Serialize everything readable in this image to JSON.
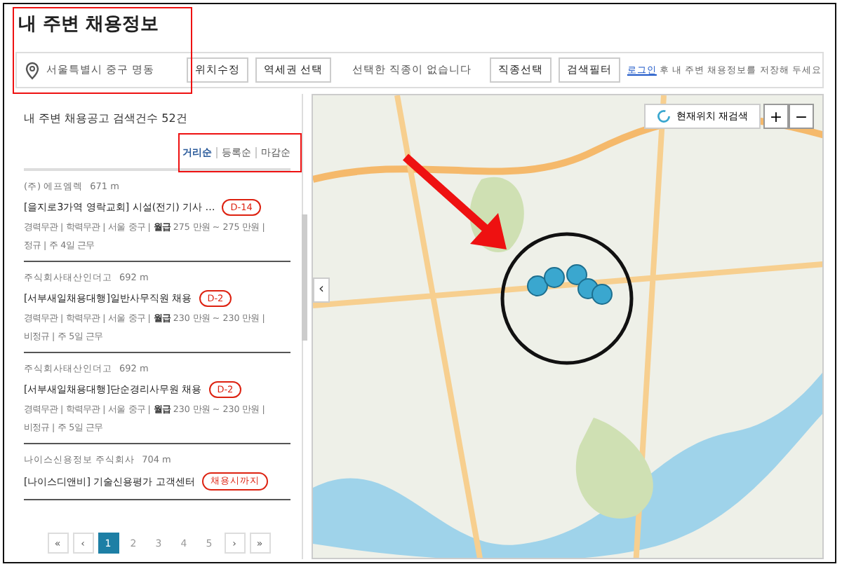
{
  "title": "내 주변 채용정보",
  "toolbar": {
    "location": "서울특별시 중구 명동",
    "location_buttons": [
      "위치수정",
      "역세권 선택"
    ],
    "job_type": "선택한 직종이 없습니다",
    "job_buttons": [
      "직종선택",
      "검색필터"
    ],
    "login_link": "로그인",
    "login_note": " 후 내 주변 채용정보를 저장해 두세요"
  },
  "list": {
    "heading": "내 주변 채용공고 검색건수 52건",
    "sort": [
      {
        "label": "거리순",
        "selected": true
      },
      {
        "label": "등록순",
        "selected": false
      },
      {
        "label": "마감순",
        "selected": false
      }
    ],
    "jobs": [
      {
        "company": "(주) 에프엠렉",
        "distance": "671 m",
        "title": "[을지로3가역 영락교회] 시설(전기) 기사 …",
        "badge": "D-14",
        "details": "경력무관 | 학력무관 | 서울 중구 | **월급** 275 만원 ~ 275 만원 |",
        "terms": "정규 | 주 4일 근무"
      },
      {
        "company": "주식회사태산인더고",
        "distance": "692 m",
        "title": "[서부새일채용대행]일반사무직원 채용",
        "badge": "D-2",
        "details": "경력무관 | 학력무관 | 서울 중구 | **월급** 230 만원 ~ 230 만원 |",
        "terms": "비정규 | 주 5일 근무"
      },
      {
        "company": "주식회사태산인더고",
        "distance": "692 m",
        "title": "[서부새일채용대행]단순경리사무원 채용",
        "badge": "D-2",
        "details": "경력무관 | 학력무관 | 서울 중구 | **월급** 230 만원 ~ 230 만원 |",
        "terms": "비정규 | 주 5일 근무"
      },
      {
        "company": "나이스신용정보 주식회사",
        "distance": "704 m",
        "title": "[나이스디앤비] 기술신용평가 고객센터",
        "badge": "채용시까지"
      }
    ],
    "pagination": [
      {
        "label": "«",
        "kind": "nav"
      },
      {
        "label": "‹",
        "kind": "nav"
      },
      {
        "label": "1",
        "kind": "page",
        "selected": true
      },
      {
        "label": "2",
        "kind": "page",
        "selected": false
      },
      {
        "label": "3",
        "kind": "page",
        "selected": false
      },
      {
        "label": "4",
        "kind": "page",
        "selected": false
      },
      {
        "label": "5",
        "kind": "page",
        "selected": false
      },
      {
        "label": "›",
        "kind": "nav"
      },
      {
        "label": "»",
        "kind": "nav"
      }
    ]
  },
  "map": {
    "research_button": "현재위치 재검색",
    "zoom_in": "+",
    "zoom_out": "−",
    "panel_toggle": "‹"
  }
}
